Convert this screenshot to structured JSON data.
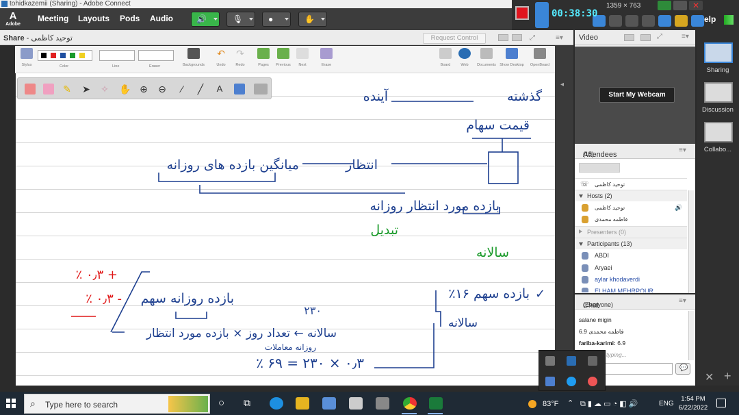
{
  "window": {
    "title": "tohidkazemii (Sharing) - Adobe Connect"
  },
  "menubar": {
    "logo_label": "Adobe",
    "items": [
      "Meeting",
      "Layouts",
      "Pods",
      "Audio"
    ]
  },
  "recorder": {
    "timer": "00:38:30",
    "dimensions": "1359 × 763",
    "overflow_label": "elp"
  },
  "share_pod": {
    "title": "Share",
    "presenter": "- توحید کاظمی",
    "request_control": "Request Control",
    "tools": [
      "Stylus",
      "Color",
      "Line",
      "Eraser",
      "Backgrounds",
      "Undo",
      "Redo",
      "Pages",
      "Previous",
      "Next",
      "Erase",
      "Board",
      "Web",
      "Documents",
      "Show Desktop",
      "OpenBoard"
    ],
    "colors": [
      "#000000",
      "#e02020",
      "#1f4fa0",
      "#1a9a2a",
      "#f0d020"
    ]
  },
  "handwriting": {
    "line1_left": "آینده",
    "line1_right": "گذشته",
    "line2": "قیمت سهام",
    "line4_left": "میانگین بازده های روزانه",
    "line4_mid": "انتظار",
    "line6": "بازده مورد انتظار روزانه",
    "green1": "تبدیل",
    "green2": "سالانه",
    "red1": "٪ ۰٫۳ +",
    "red2": "٪ ۰٫۳ -",
    "line11_mid": "بازده روزانه سهم",
    "line11_right": "٪۱۶ بازده سهم",
    "line12_right": "سالانه",
    "line13_num": "۲۳۰",
    "line14": "سالانه ← تعداد روز × بازده مورد انتظار",
    "line14b": "روزانه     معاملات",
    "line15": "٪ ۶۹ = ۲۳۰ × ۰٫۳"
  },
  "video_pod": {
    "title": "Video",
    "start_webcam": "Start My Webcam"
  },
  "attendees_pod": {
    "title": "Attendees",
    "count": "(15)",
    "me": "توحید کاظمی",
    "hosts_label": "Hosts (2)",
    "hosts": [
      "توحید کاظمی",
      "فاطمه محمدی"
    ],
    "presenters_label": "Presenters (0)",
    "participants_label": "Participants (13)",
    "participants": [
      "ABDI",
      "Aryaei",
      "aylar khodaverdi",
      "ELHAM MEHRPOUR"
    ]
  },
  "chat_pod": {
    "title": "Chat",
    "scope": "(Everyone)",
    "messages": [
      {
        "sender": "salane migin",
        "text": ""
      },
      {
        "sender": "فاطمه محمدی",
        "text": "6.9"
      },
      {
        "sender": "fariba-karimi:",
        "text": "6.9"
      }
    ],
    "typing": "typing..."
  },
  "layouts": [
    {
      "label": "Sharing",
      "selected": true
    },
    {
      "label": "Discussion",
      "selected": false
    },
    {
      "label": "Collabo...",
      "selected": false
    }
  ],
  "taskbar": {
    "search_placeholder": "Type here to search",
    "weather": "83°F",
    "lang": "ENG",
    "time": "1:54 PM",
    "date": "6/22/2022"
  }
}
